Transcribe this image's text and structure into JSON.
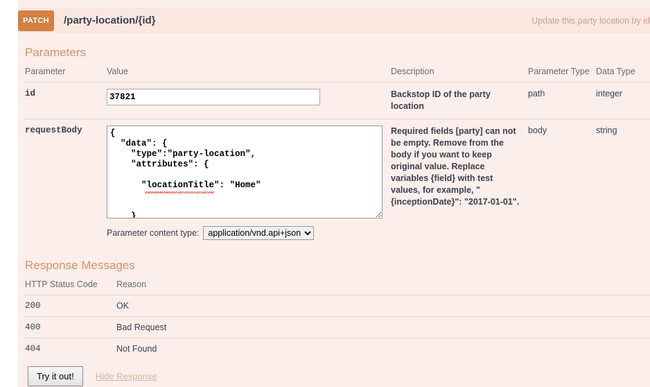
{
  "operation": {
    "method": "PATCH",
    "path": "/party-location/{id}",
    "summary": "Update this party location by id"
  },
  "parameters_section": {
    "title": "Parameters",
    "columns": {
      "parameter": "Parameter",
      "value": "Value",
      "description": "Description",
      "parameter_type": "Parameter Type",
      "data_type": "Data Type"
    },
    "rows": [
      {
        "name": "id",
        "value": "37821",
        "description": "Backstop ID of the party location",
        "parameter_type": "path",
        "data_type": "integer"
      },
      {
        "name": "requestBody",
        "value": "{\n  \"data\": {\n    \"type\":\"party-location\",\n    \"attributes\": {\n\n      \"locationTitle\": \"Home\"\n\n\n    }\n  }\n}",
        "description": "Required fields [party] can not be empty. Remove from the body if you want to keep original value. Replace variables {field} with test values, for example, \" {inceptionDate}\": \"2017-01-01\".",
        "parameter_type": "body",
        "data_type": "string"
      }
    ],
    "content_type_label": "Parameter content type:",
    "content_type_selected": "application/vnd.api+json",
    "content_type_options": [
      "application/vnd.api+json"
    ]
  },
  "responses_section": {
    "title": "Response Messages",
    "columns": {
      "status_code": "HTTP Status Code",
      "reason": "Reason"
    },
    "rows": [
      {
        "code": "200",
        "reason": "OK"
      },
      {
        "code": "400",
        "reason": "Bad Request"
      },
      {
        "code": "404",
        "reason": "Not Found"
      }
    ]
  },
  "footer": {
    "try_it_out_label": "Try it out!",
    "hide_response_label": "Hide Response"
  },
  "colors": {
    "patch_badge": "#d38042",
    "block_background": "#fbeeeb",
    "header_background": "#fae7e0",
    "section_title": "#d3946a",
    "summary_text": "#d0a08a",
    "prev_block_green": "#10a256"
  }
}
